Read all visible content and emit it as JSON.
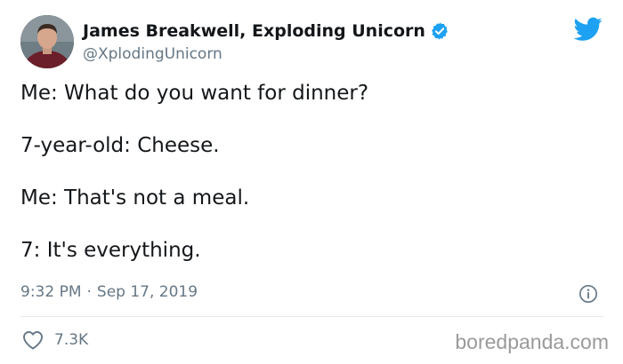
{
  "author": {
    "name": "James Breakwell, Exploding Unicorn",
    "handle": "@XplodingUnicorn",
    "verified_icon": "verified-badge-icon",
    "avatar_icon": "profile-avatar"
  },
  "platform_icon": "twitter-bird-icon",
  "tweet": {
    "lines": [
      "Me: What do you want for dinner?",
      "7-year-old: Cheese.",
      "Me: That's not a meal.",
      "7: It's everything."
    ],
    "time": "9:32 PM",
    "separator": "·",
    "date": "Sep 17, 2019",
    "info_icon": "info-icon"
  },
  "engagement": {
    "like_icon": "heart-icon",
    "likes": "7.3K"
  },
  "watermark": "boredpanda.com",
  "colors": {
    "twitter_blue": "#1da1f2",
    "text_primary": "#14171a",
    "text_secondary": "#657786",
    "divider": "#e1e8ed"
  }
}
